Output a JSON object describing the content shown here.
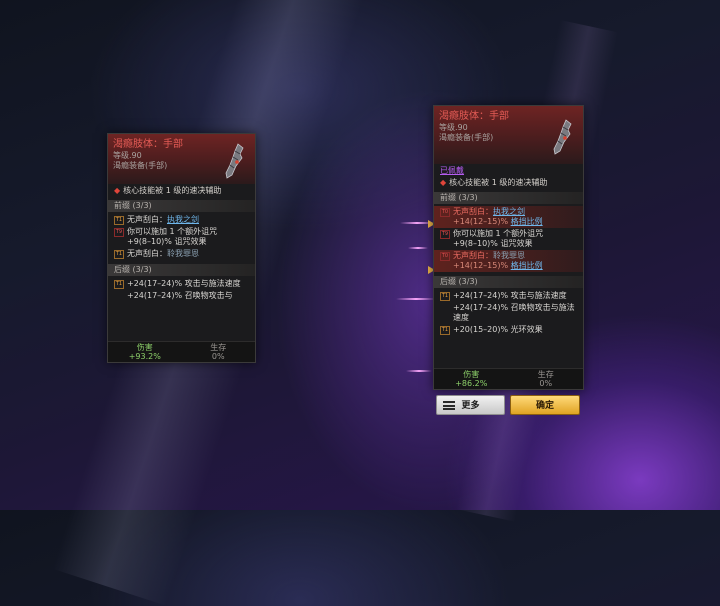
{
  "left_card": {
    "name": "渴瘾肢体：手部",
    "level": "等级.90",
    "type": "渴瘾装备(手部)",
    "core_skill": "核心技能被 1 级的速决辅助",
    "prefix_header": "前缀 (3/3)",
    "prefixes": [
      {
        "badge": "T1",
        "text_a": "无声刮白：",
        "link": "执我之剑",
        "line2": ""
      },
      {
        "badge": "T9",
        "text_a": "你可以施加 1 个额外诅咒",
        "link": "",
        "line2": "+9(8–10)% 诅咒效果"
      },
      {
        "badge": "T1",
        "text_a": "无声刮白：",
        "link": "聆我罪恩",
        "line2": ""
      }
    ],
    "suffix_header": "后缀 (3/3)",
    "suffixes": [
      {
        "badge": "T1",
        "text": "+24(17–24)% 攻击与施法速度"
      },
      {
        "badge": "",
        "text": "+24(17–24)% 召唤物攻击与"
      }
    ],
    "footer": {
      "dmg_label": "伤害",
      "dmg_value": "+93.2%",
      "surv_label": "生存",
      "surv_value": "0%"
    }
  },
  "right_card": {
    "name": "渴瘾肢体：手部",
    "level": "等级.90",
    "type": "渴瘾装备(手部)",
    "equipped": "已佩戴",
    "core_skill": "核心技能被 1 级的速决辅助",
    "prefix_header": "前缀 (3/3)",
    "prefixes": [
      {
        "badge": "T0",
        "t1": "无声刮白：",
        "link": "执我之剑",
        "t2": "+14(12–15)%",
        "link2": "格挡比例",
        "highlight": true
      },
      {
        "badge": "T9",
        "t1": "你可以施加 1 个额外诅咒",
        "link": "",
        "t2": "+9(8–10)% 诅咒效果",
        "link2": "",
        "highlight": false
      },
      {
        "badge": "T0",
        "t1": "无声刮白：",
        "link": "聆我罪恩",
        "t2": "+14(12–15)%",
        "link2": "格挡比例",
        "highlight": true
      }
    ],
    "suffix_header": "后缀 (3/3)",
    "suffixes": [
      {
        "badge": "T1",
        "text": "+24(17–24)% 攻击与施法速度"
      },
      {
        "badge": "",
        "text": "+24(17–24)% 召唤物攻击与施法速度"
      },
      {
        "badge": "T1",
        "text": "+20(15–20)% 光环效果"
      }
    ],
    "footer": {
      "dmg_label": "伤害",
      "dmg_value": "+86.2%",
      "surv_label": "生存",
      "surv_value": "0%"
    }
  },
  "buttons": {
    "more": "更多",
    "confirm": "确定"
  },
  "colors": {
    "accent_gold": "#e0a323",
    "item_red": "#e35b55",
    "link_blue": "#6fb6ea",
    "equipped_purple": "#b55cf0"
  }
}
